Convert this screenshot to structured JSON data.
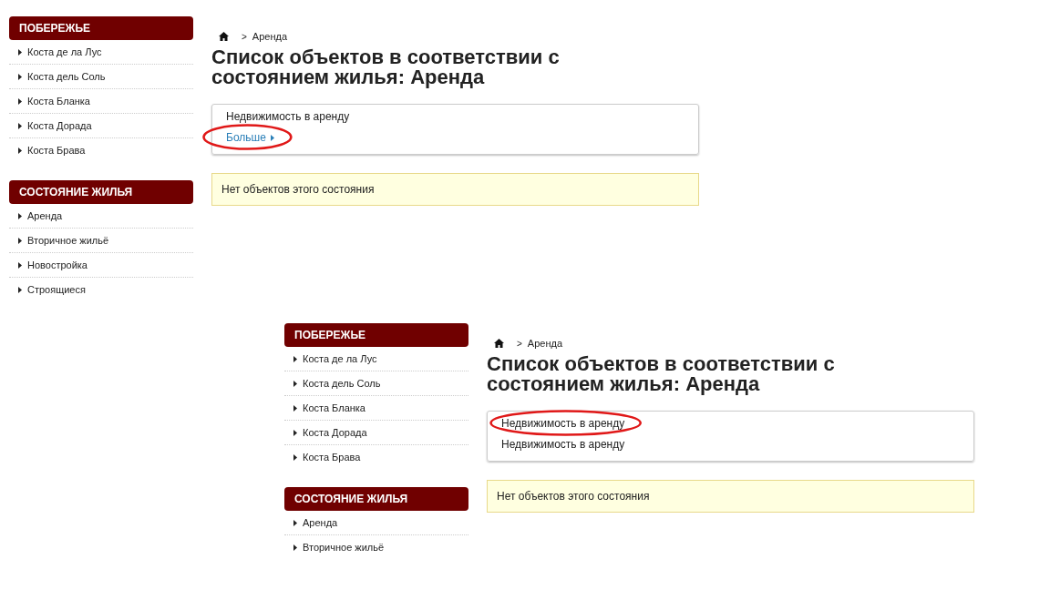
{
  "panels": [
    {
      "sidebar": [
        {
          "title": "ПОБЕРЕЖЬЕ",
          "items": [
            {
              "label": "Коста де ла Лус"
            },
            {
              "label": "Коста дель Соль"
            },
            {
              "label": "Коста Бланка"
            },
            {
              "label": "Коста Дорада"
            },
            {
              "label": "Коста Брава"
            }
          ]
        },
        {
          "title": "СОСТОЯНИЕ ЖИЛЬЯ",
          "items": [
            {
              "label": "Аренда"
            },
            {
              "label": "Вторичное жильё"
            },
            {
              "label": "Новостройка"
            },
            {
              "label": "Строящиеся"
            }
          ]
        }
      ],
      "breadcrumb": {
        "separator": ">",
        "current": "Аренда"
      },
      "heading": "Список объектов в соответствии с состоянием жилья: Аренда",
      "box": [
        {
          "kind": "text",
          "label": "Недвижимость в аренду",
          "highlighted": false
        },
        {
          "kind": "link",
          "label": "Больше",
          "highlighted": true
        }
      ],
      "notice": "Нет объектов этого состояния"
    },
    {
      "sidebar": [
        {
          "title": "ПОБЕРЕЖЬЕ",
          "items": [
            {
              "label": "Коста де ла Лус"
            },
            {
              "label": "Коста дель Соль"
            },
            {
              "label": "Коста Бланка"
            },
            {
              "label": "Коста Дорада"
            },
            {
              "label": "Коста Брава"
            }
          ]
        },
        {
          "title": "СОСТОЯНИЕ ЖИЛЬЯ",
          "items": [
            {
              "label": "Аренда"
            },
            {
              "label": "Вторичное жильё"
            }
          ]
        }
      ],
      "breadcrumb": {
        "separator": ">",
        "current": "Аренда"
      },
      "heading": "Список объектов в соответствии с состоянием жилья: Аренда",
      "box": [
        {
          "kind": "text",
          "label": "Недвижимость в аренду",
          "highlighted": true
        },
        {
          "kind": "text",
          "label": "Недвижимость в аренду",
          "highlighted": false
        }
      ],
      "notice": "Нет объектов этого состояния"
    }
  ]
}
